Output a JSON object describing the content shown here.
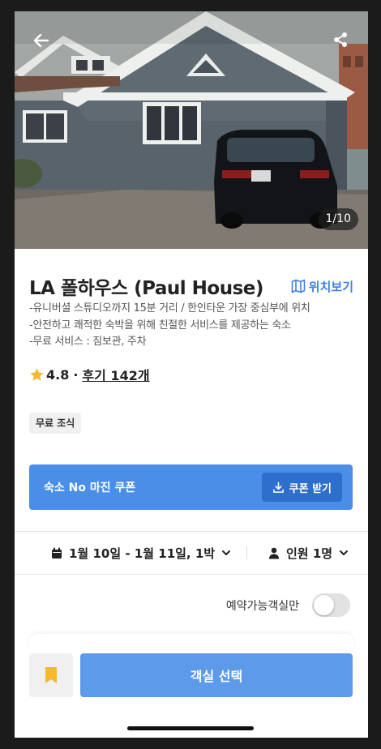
{
  "hero": {
    "photo_counter": "1/10",
    "back_icon": "arrow-left-icon",
    "share_icon": "share-icon"
  },
  "listing": {
    "title": "LA 폴하우스 (Paul House)",
    "map_link_label": "위치보기",
    "description_lines": [
      "-유니버셜 스튜디오까지 15분 거리 / 한인타운 가장 중심부에 위치",
      "-안전하고 쾌적한 숙박을 위해 친절한 서비스를 제공하는 숙소",
      "-무료 서비스 : 짐보관, 주차"
    ],
    "rating": "4.8",
    "rating_separator": "·",
    "reviews_label": "후기 142개",
    "amenity_chip": "무료 조식"
  },
  "coupon": {
    "title": "숙소 No 마진 쿠폰",
    "button_label": "쿠폰 받기"
  },
  "filters": {
    "dates": "1월 10일 - 1월 11일, 1박",
    "guests": "인원 1명"
  },
  "availability": {
    "label": "예약가능객실만",
    "toggle_on": false
  },
  "bottom_bar": {
    "select_button_label": "객실 선택"
  },
  "colors": {
    "accent_blue": "#4a8ee7",
    "coupon_button": "#2f6fcc",
    "select_button": "#5d9bea",
    "star": "#f5b82e",
    "bookmark": "#f5b82e"
  }
}
